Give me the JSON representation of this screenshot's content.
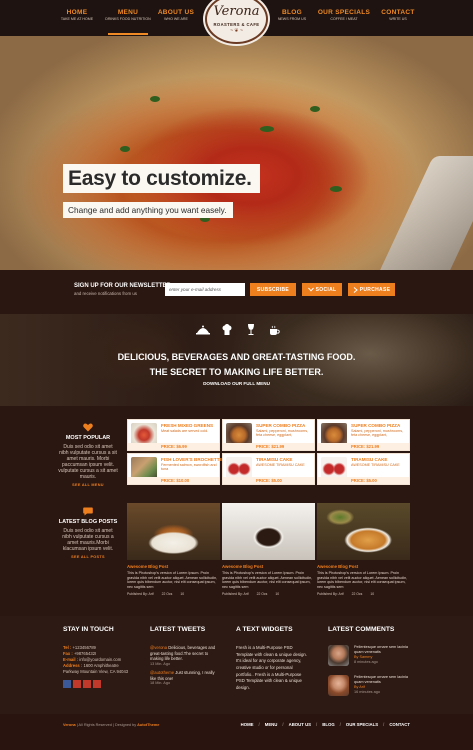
{
  "brand": {
    "name": "Verona",
    "tagline": "ROASTERS & CAFE",
    "ornament": "~ ❦ ~"
  },
  "nav": [
    {
      "label": "HOME",
      "sub": "TAKE ME AT HOME"
    },
    {
      "label": "MENU",
      "sub": "DRINKS FOOD NUTRITION"
    },
    {
      "label": "ABOUT US",
      "sub": "WHO WE ARE"
    },
    {
      "label": "BLOG",
      "sub": "NEWS FROM US"
    },
    {
      "label": "OUR SPECIALS",
      "sub": "COFFEE / MEAT"
    },
    {
      "label": "CONTACT",
      "sub": "WRITE US"
    }
  ],
  "hero": {
    "title": "Easy to customize.",
    "subtitle": "Change and add anything you want easely."
  },
  "newsletter": {
    "title": "SIGN UP FOR OUR NEWSLETTER",
    "note": "and receive notifications from us",
    "placeholder": "enter your e-mail address",
    "subscribe": "SUBSCRIBE",
    "social": "SOCIAL",
    "purchase": "PURCHASE"
  },
  "banner": {
    "line1": "DELICIOUS, BEVERAGES AND GREAT-TASTING FOOD.",
    "line2": "THE SECRET TO MAKING LIFE BETTER.",
    "cta": "DOWNLOAD OUR FULL MENU",
    "icons": [
      "cloche-icon",
      "chef-hat-icon",
      "wine-glass-icon",
      "coffee-cup-icon"
    ]
  },
  "popular": {
    "title": "MOST POPULAR",
    "text": "Duis sed odio sit amet nibh vulputate cursus a sit amet mauris. Morbi paccumsan ipsum velit. vulputate cursus a sit amet mauris.",
    "more": "SEE ALL MENU"
  },
  "menu_items": [
    {
      "name": "FRESH MIXED GREENS",
      "desc": "Meat salads are served cold.",
      "price": "PRICE: $6.99"
    },
    {
      "name": "SUPER COMBO PIZZA",
      "desc": "Salami, pepperoni, mushrooms, feta cheese, eggplant,",
      "price": "PRICE: $21.99"
    },
    {
      "name": "SUPER COMBO PIZZA",
      "desc": "Salami, pepperoni, mushrooms, feta cheese, eggplant,",
      "price": "PRICE: $21.99"
    },
    {
      "name": "FISH LOVER'S BROCHETTE",
      "desc": "Fermented salmon, swordfish and tuna",
      "price": "PRICE: $10.00"
    },
    {
      "name": "TIRAMISU CAKE",
      "desc": "AWESOME TIRAMISU CAKE",
      "price": "PRICE: $5.00"
    },
    {
      "name": "TIRAMISU CAKE",
      "desc": "AWESOME TIRAMISU CAKE",
      "price": "PRICE: $5.00"
    }
  ],
  "blog": {
    "title": "LATEST BLOG POSTS",
    "text": "Duis sed odio sit amet nibh vulputate cursus a amet mauris.Morbi klacumsan ipsum velit.",
    "more": "SEE ALL POSTS",
    "posts": [
      {
        "title": "Awesome Blog Post",
        "text": "This is Photoshop's version of Lorem Ipsum. Proin gravida nibh vel velit auctor aliquet. Aenean sollicitudin, lorem quis bibendum auctor, nisi elit consequat ipsum, nec sagittis sem",
        "author": "Published By: Arif",
        "comments": "22 Ocs",
        "views": "10"
      },
      {
        "title": "Awesome Blog Post",
        "text": "This is Photoshop's version of Lorem Ipsum. Proin gravida nibh vel velit auctor aliquet. Aenean sollicitudin, lorem quis bibendum auctor, nisi elit consequat ipsum, nec sagittis sem",
        "author": "Published By: Arif",
        "comments": "22 Ocs",
        "views": "10"
      },
      {
        "title": "Awesome Blog Post",
        "text": "This is Photoshop's version of Lorem Ipsum. Proin gravida nibh vel velit auctor aliquet. Aenean sollicitudin, lorem quis bibendum auctor, nisi elit consequat ipsum, nec sagittis sem",
        "author": "Published By: Arif",
        "comments": "22 Ocs",
        "views": "10"
      }
    ]
  },
  "footer": {
    "contact": {
      "title": "STAY IN TOUCH",
      "tel_label": "Tel :",
      "tel": "+123456789",
      "fax_label": "Fax :",
      "fax": "+98765432I",
      "email_label": "E-mail :",
      "email": "info@yourdomain.com",
      "addr_label": "Address :",
      "addr": "1600 Amphitheatre Parkway Mountain View, CA 94043"
    },
    "tweets": {
      "title": "LATEST TWEETS",
      "items": [
        {
          "user": "@verona",
          "text": "Delicious, beverages and great-tasting food.The secret to making life better.",
          "time": "13 Min. Ago"
        },
        {
          "user": "@autotheme",
          "text": "Just stunning, I really like this one!",
          "time": "18 Min. Ago"
        }
      ]
    },
    "widget": {
      "title": "A TEXT WIDGETS",
      "text": "Fresh is a Multi-Purpose PSD Template with clean & unique design. It's ideal for any corporate agency, creative studio or for personal portfolio.. Fresh is a Multi-Purpose PSD Template with clean & unique design."
    },
    "comments": {
      "title": "LATEST COMMENTS",
      "items": [
        {
          "text": "Pellentesque ornare sem lacinia quam venenatis",
          "by": "By Sammy",
          "time": "8 minutes ago"
        },
        {
          "text": "Pellentesque ornare sem lacinia quam venenatis",
          "by": "By Arif",
          "time": "16 minutes ago"
        }
      ]
    }
  },
  "bottom": {
    "brand": "Verona",
    "copy": " | All Rights Reserved | Designed by ",
    "designer": "AutotTheme",
    "links": [
      "HOME",
      "MENU",
      "ABOUT US",
      "BLOG",
      "OUR SPECIALS",
      "CONTACT"
    ]
  },
  "colors": {
    "accent": "#ee7f1f",
    "dark": "#2b1711",
    "card": "#ffffff"
  }
}
